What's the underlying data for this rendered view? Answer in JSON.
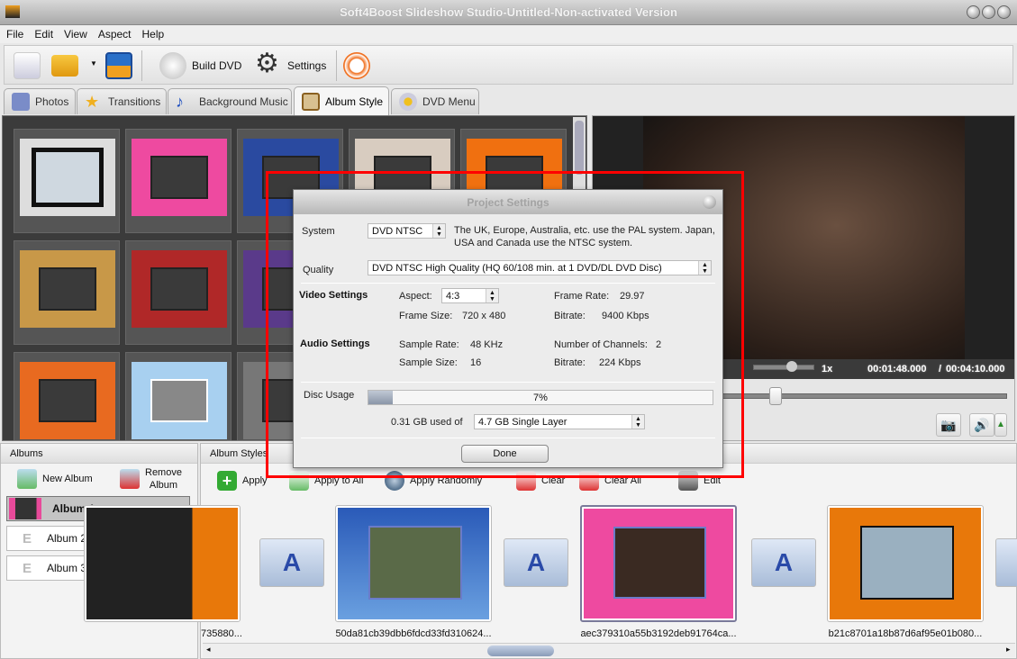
{
  "window": {
    "title": "Soft4Boost Slideshow Studio-Untitled-Non-activated Version"
  },
  "menu": [
    "File",
    "Edit",
    "View",
    "Aspect",
    "Help"
  ],
  "toolbar": {
    "build_dvd": "Build DVD",
    "settings": "Settings"
  },
  "tabs": [
    "Photos",
    "Transitions",
    "Background Music",
    "Album Style",
    "DVD Menu"
  ],
  "active_tab": "Album Style",
  "player": {
    "speed": "1x",
    "current_time": "00:01:48.000",
    "total_time": "00:04:10.000",
    "separator": "/"
  },
  "albums_panel": {
    "title": "Albums",
    "new_album": "New Album",
    "remove_album_line1": "Remove",
    "remove_album_line2": "Album",
    "albums": [
      "Album 1",
      "Album 2",
      "Album 3"
    ],
    "selected": "Album 1",
    "empty_glyph": "E"
  },
  "styles_panel": {
    "title": "Album Styles",
    "buttons": [
      "Apply",
      "Apply to All",
      "Apply Randomly",
      "Clear",
      "Clear All",
      "Edit"
    ],
    "filenames": [
      "735880...",
      "50da81cb39dbb6fdcd33fd310624...",
      "aec379310a55b3192deb91764ca...",
      "b21c8701a18b87d6af95e01b080..."
    ],
    "transition_glyph": "A"
  },
  "dialog": {
    "title": "Project Settings",
    "system_label": "System",
    "system_value": "DVD NTSC",
    "system_note": "The UK, Europe, Australia, etc. use the PAL system. Japan, USA and Canada use the NTSC system.",
    "quality_label": "Quality",
    "quality_value": "DVD NTSC High Quality (HQ 60/108 min. at 1 DVD/DL DVD Disc)",
    "video_heading": "Video Settings",
    "aspect_label": "Aspect:",
    "aspect_value": "4:3",
    "frame_rate_label": "Frame Rate:",
    "frame_rate_value": "29.97",
    "frame_size_label": "Frame Size:",
    "frame_size_value": "720 x 480",
    "video_bitrate_label": "Bitrate:",
    "video_bitrate_value": "9400 Kbps",
    "audio_heading": "Audio Settings",
    "sample_rate_label": "Sample Rate:",
    "sample_rate_value": "48 KHz",
    "channels_label": "Number of Channels:",
    "channels_value": "2",
    "sample_size_label": "Sample Size:",
    "sample_size_value": "16",
    "audio_bitrate_label": "Bitrate:",
    "audio_bitrate_value": "224 Kbps",
    "disc_usage_label": "Disc Usage",
    "disc_usage_percent": 7,
    "disc_usage_text": "7%",
    "used_text": "0.31 GB used of",
    "disc_type": "4.7 GB Single Layer",
    "done": "Done"
  },
  "colors": {
    "highlight": "#ff0000",
    "grid_bg": "#3b3b3b"
  }
}
